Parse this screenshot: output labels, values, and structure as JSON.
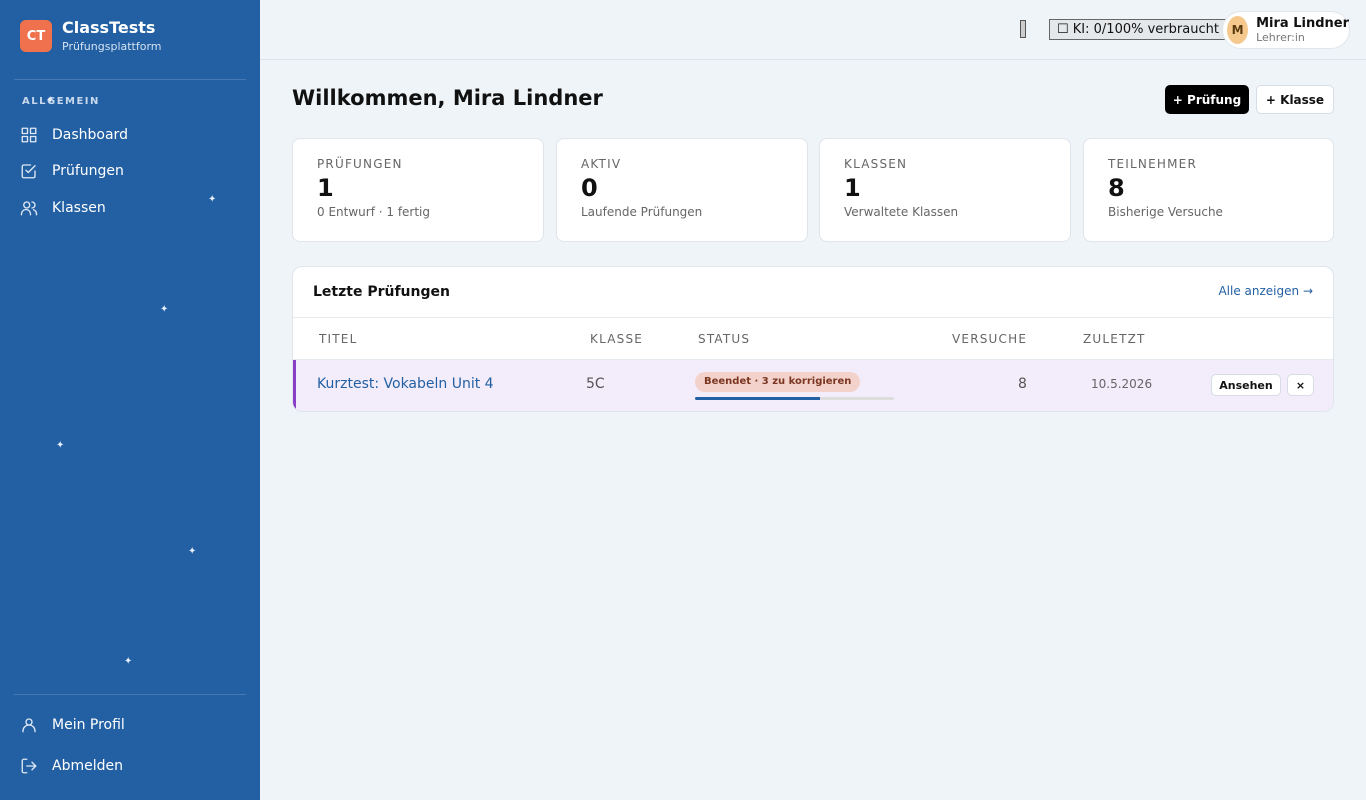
{
  "sidebar": {
    "logo": "CT",
    "brand_title": "ClassTests",
    "brand_subtitle": "Prüfungsplattform",
    "section_label": "ALLGEMEIN",
    "nav": [
      {
        "label": "Dashboard",
        "icon": "dashboard-icon"
      },
      {
        "label": "Prüfungen",
        "icon": "checklist-icon"
      },
      {
        "label": "Klassen",
        "icon": "users-icon"
      }
    ],
    "bottom_nav": [
      {
        "label": "Mein Profil",
        "icon": "user-icon"
      },
      {
        "label": "Abmelden",
        "icon": "logout-icon"
      }
    ]
  },
  "header": {
    "ki_usage": "☐ KI: 0/100% verbraucht",
    "user": {
      "initial": "M",
      "name": "Mira Lindner",
      "role": "Lehrer:in"
    }
  },
  "main": {
    "title": "Willkommen, Mira Lindner",
    "new_exam_button": "+ Prüfung",
    "new_class_button": "+ Klasse",
    "stats": [
      {
        "label": "PRÜFUNGEN",
        "value": "1",
        "sub": "0 Entwurf · 1 fertig"
      },
      {
        "label": "AKTIV",
        "value": "0",
        "sub": "Laufende Prüfungen"
      },
      {
        "label": "KLASSEN",
        "value": "1",
        "sub": "Verwaltete Klassen"
      },
      {
        "label": "TEILNEHMER",
        "value": "8",
        "sub": "Bisherige Versuche"
      }
    ],
    "recent": {
      "title": "Letzte Prüfungen",
      "show_all": "Alle anzeigen →",
      "columns": [
        "TITEL",
        "KLASSE",
        "STATUS",
        "VERSUCHE",
        "ZULETZT"
      ],
      "rows": [
        {
          "title": "Kurztest: Vokabeln Unit 4",
          "class": "5C",
          "status": "Beendet · 3 zu korrigieren",
          "progress_percent": 63,
          "attempts": "8",
          "last": "10.5.2026",
          "view_label": "Ansehen",
          "close_label": "×"
        }
      ]
    }
  },
  "colors": {
    "sidebar": "#2360a3",
    "logo": "#f0714e",
    "accent_purple": "#8a3fc8",
    "badge_bg": "#f3d2cb"
  }
}
